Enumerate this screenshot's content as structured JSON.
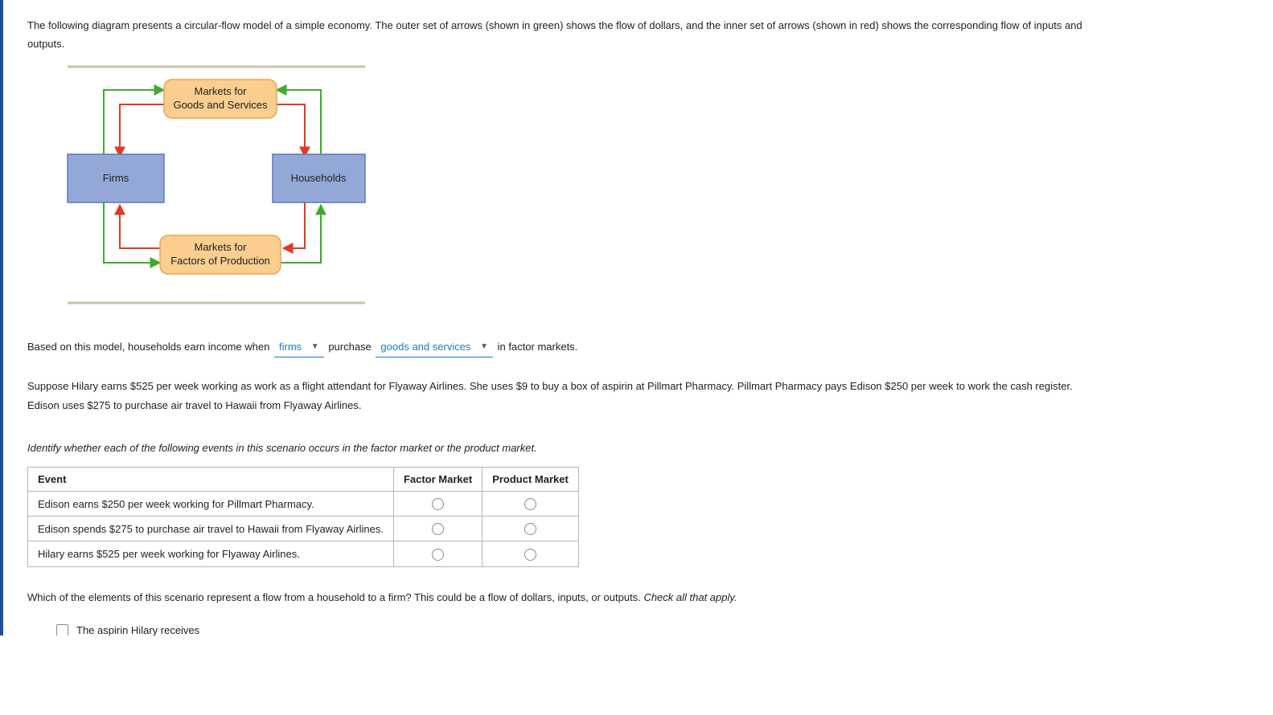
{
  "intro": "The following diagram presents a circular-flow model of a simple economy. The outer set of arrows (shown in green) shows the flow of dollars, and the inner set of arrows (shown in red) shows the corresponding flow of inputs and outputs.",
  "diagram": {
    "top_box_l1": "Markets for",
    "top_box_l2": "Goods and Services",
    "left_box": "Firms",
    "right_box": "Households",
    "bottom_box_l1": "Markets for",
    "bottom_box_l2": "Factors of Production",
    "colors": {
      "green": "#3eab2e",
      "red": "#e03a27",
      "orange_fill": "#f9ce8e",
      "orange_stroke": "#e8a651",
      "blue_fill": "#93a8d6",
      "blue_stroke": "#5b79c2",
      "rule": "#c7c1ab"
    }
  },
  "fill_in": {
    "prefix": "Based on this model, households earn income when",
    "dd1": "firms",
    "mid": "purchase",
    "dd2": "goods and services",
    "suffix": "in factor markets."
  },
  "story": "Suppose Hilary earns $525 per week working as work as a flight attendant for Flyaway Airlines. She uses $9 to buy a box of aspirin at Pillmart Pharmacy. Pillmart Pharmacy pays Edison $250 per week to work the cash register. Edison uses $275 to purchase air travel to Hawaii from Flyaway Airlines.",
  "table_instruction": "Identify whether each of the following events in this scenario occurs in the factor market or the product market.",
  "table": {
    "head_event": "Event",
    "head_factor": "Factor Market",
    "head_product": "Product Market",
    "rows": [
      "Edison earns $250 per week working for Pillmart Pharmacy.",
      "Edison spends $275 to purchase air travel to Hawaii from Flyaway Airlines.",
      "Hilary earns $525 per week working for Flyaway Airlines."
    ]
  },
  "flow_q": {
    "text": "Which of the elements of this scenario represent a flow from a household to a firm? This could be a flow of dollars, inputs, or outputs. ",
    "tail": "Check all that apply."
  },
  "checks": [
    "The aspirin Hilary receives"
  ]
}
